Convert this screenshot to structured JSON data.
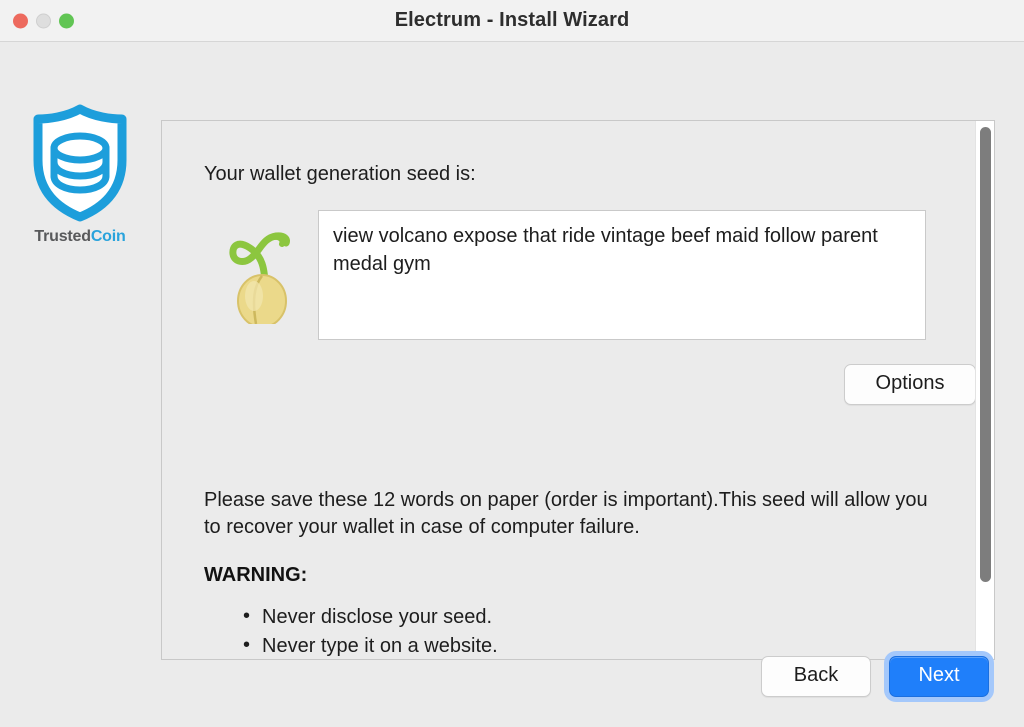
{
  "window": {
    "title": "Electrum  -  Install Wizard",
    "controls": {
      "close": "close-button",
      "minimize": "minimize-button",
      "zoom": "zoom-button"
    }
  },
  "branding": {
    "name_part1": "Trusted",
    "name_part2": "Coin",
    "icon": "shield-coins-icon",
    "color_primary": "#29a3dc",
    "color_text": "#58595b"
  },
  "content": {
    "heading": "Your wallet generation seed is:",
    "seed_icon": "sprouting-seed-icon",
    "seed_phrase": "view volcano expose that ride vintage beef maid follow parent medal gym",
    "options_label": "Options",
    "instructions": "Please save these 12 words on paper (order is important).This seed will allow you to recover your wallet in case of computer failure.",
    "warning_title": "WARNING:",
    "warnings": [
      "Never disclose your seed.",
      "Never type it on a website."
    ]
  },
  "scrollbar": {
    "name": "vertical-scrollbar",
    "thumb_color": "#7d7d7d"
  },
  "footer": {
    "back_label": "Back",
    "next_label": "Next",
    "next_accent": "#1f7ffa"
  }
}
